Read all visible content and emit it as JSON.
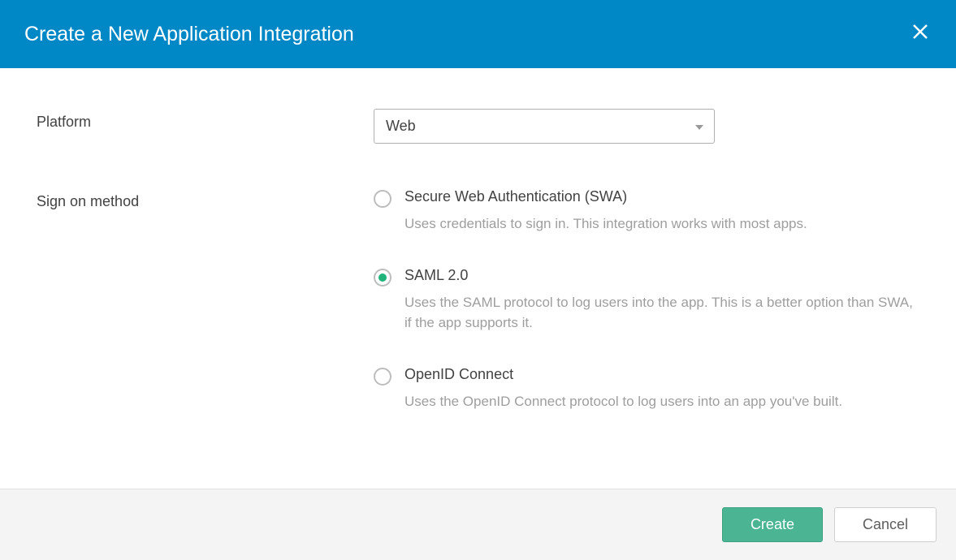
{
  "header": {
    "title": "Create a New Application Integration"
  },
  "form": {
    "platform": {
      "label": "Platform",
      "selected": "Web"
    },
    "signOnMethod": {
      "label": "Sign on method",
      "options": [
        {
          "title": "Secure Web Authentication (SWA)",
          "desc": "Uses credentials to sign in. This integration works with most apps.",
          "selected": false
        },
        {
          "title": "SAML 2.0",
          "desc": "Uses the SAML protocol to log users into the app. This is a better option than SWA, if the app supports it.",
          "selected": true
        },
        {
          "title": "OpenID Connect",
          "desc": "Uses the OpenID Connect protocol to log users into an app you've built.",
          "selected": false
        }
      ]
    }
  },
  "footer": {
    "create": "Create",
    "cancel": "Cancel"
  }
}
